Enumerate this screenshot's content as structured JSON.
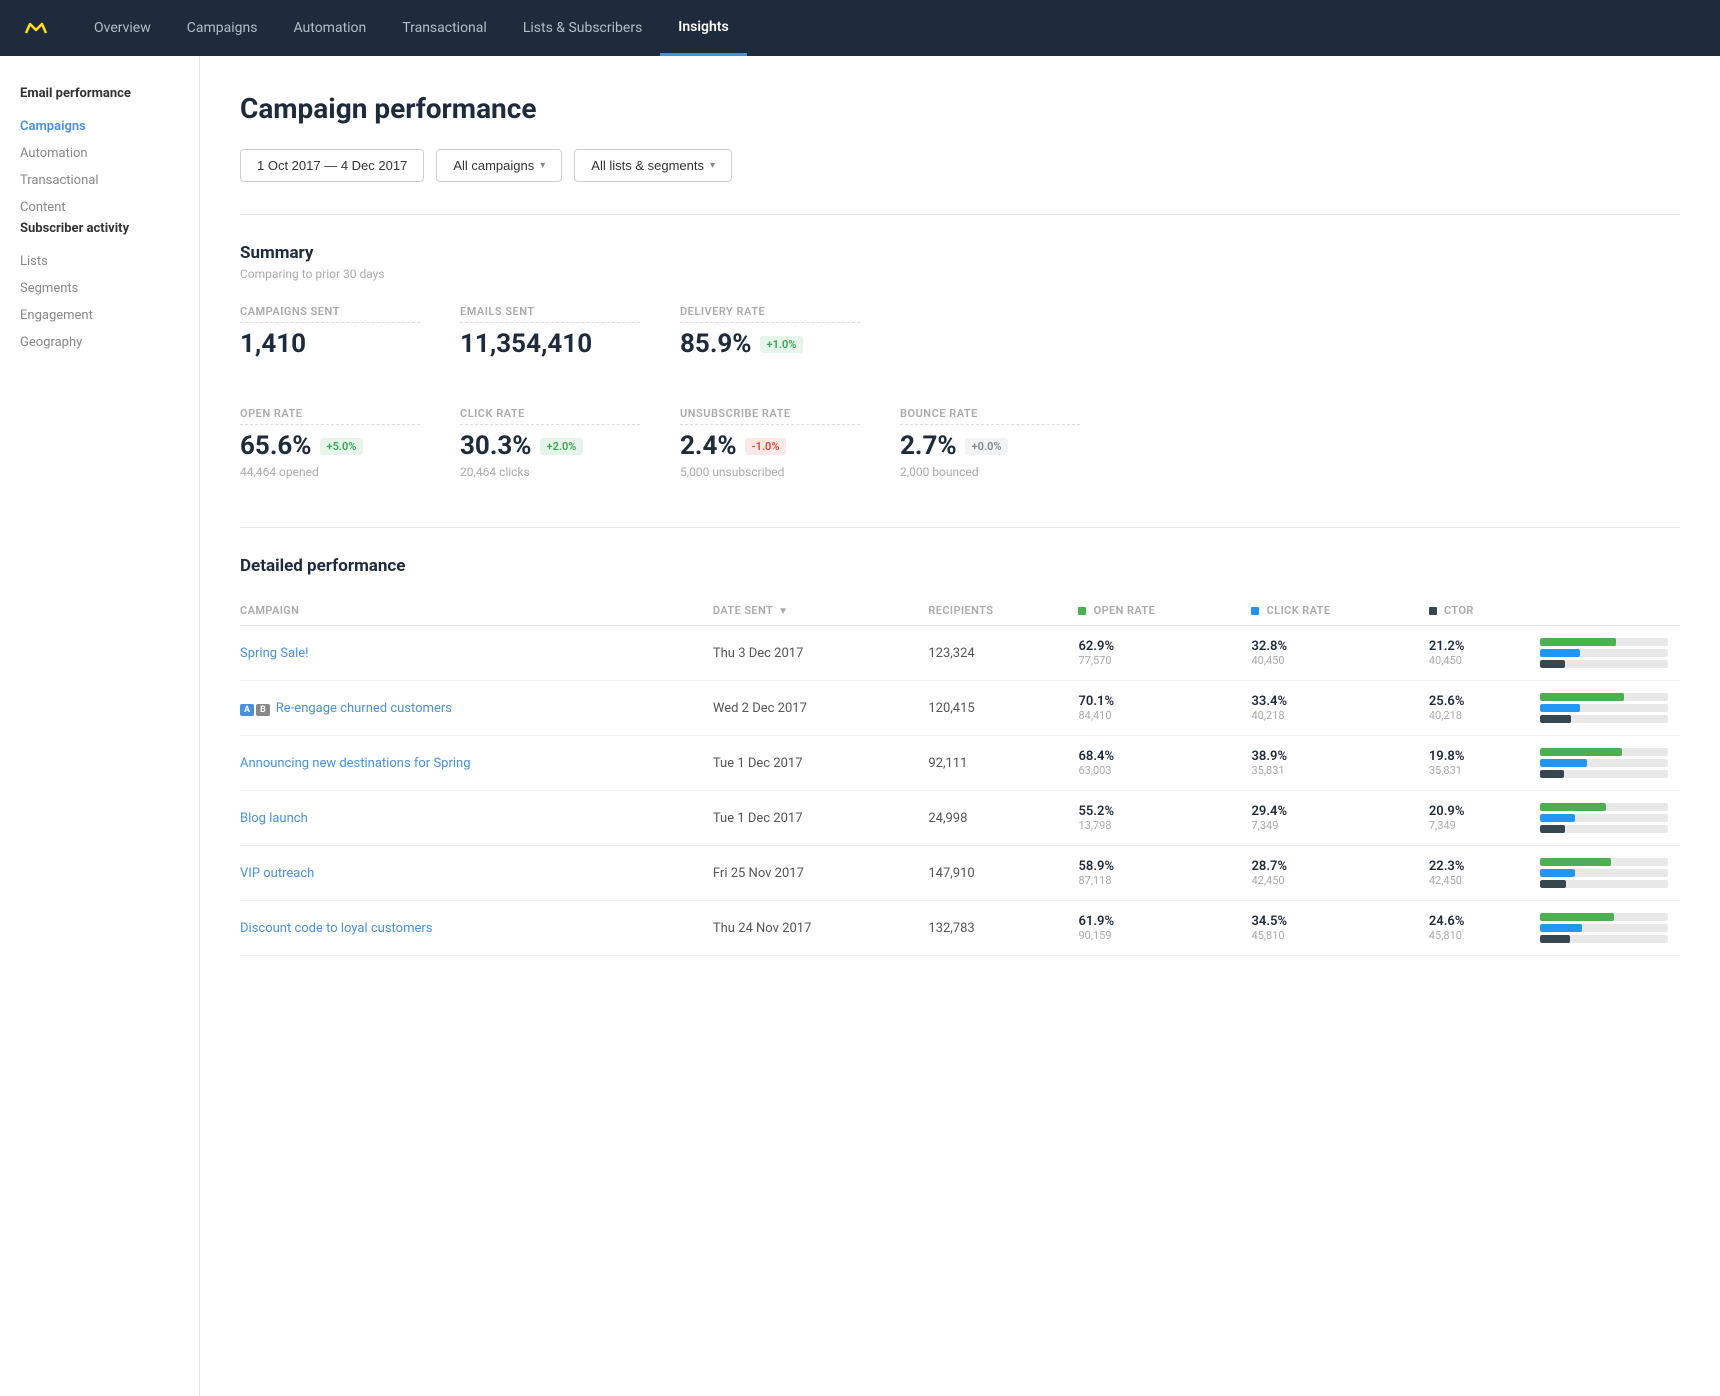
{
  "nav": {
    "logo_alt": "Mailchimp",
    "items": [
      {
        "label": "Overview",
        "active": false
      },
      {
        "label": "Campaigns",
        "active": false
      },
      {
        "label": "Automation",
        "active": false
      },
      {
        "label": "Transactional",
        "active": false
      },
      {
        "label": "Lists & Subscribers",
        "active": false
      },
      {
        "label": "Insights",
        "active": true
      }
    ]
  },
  "sidebar": {
    "sections": [
      {
        "title": "Email performance",
        "links": [
          {
            "label": "Campaigns",
            "active": true
          },
          {
            "label": "Automation",
            "active": false
          },
          {
            "label": "Transactional",
            "active": false
          },
          {
            "label": "Content",
            "active": false
          }
        ]
      },
      {
        "title": "Subscriber activity",
        "links": [
          {
            "label": "Lists",
            "active": false
          },
          {
            "label": "Segments",
            "active": false
          },
          {
            "label": "Engagement",
            "active": false
          },
          {
            "label": "Geography",
            "active": false
          }
        ]
      }
    ]
  },
  "page": {
    "title": "Campaign performance"
  },
  "filters": {
    "date_range": "1 Oct 2017 — 4 Dec 2017",
    "campaign_filter": "All campaigns",
    "segment_filter": "All lists & segments"
  },
  "summary": {
    "title": "Summary",
    "subtitle": "Comparing to prior 30 days",
    "stats_row1": [
      {
        "label": "CAMPAIGNS SENT",
        "value": "1,410",
        "sub": null,
        "badge": null
      },
      {
        "label": "EMAILS SENT",
        "value": "11,354,410",
        "sub": null,
        "badge": null
      },
      {
        "label": "DELIVERY RATE",
        "value": "85.9%",
        "sub": null,
        "badge": "+1.0%",
        "badge_type": "green"
      }
    ],
    "stats_row2": [
      {
        "label": "OPEN RATE",
        "value": "65.6%",
        "sub": "44,464 opened",
        "badge": "+5.0%",
        "badge_type": "green"
      },
      {
        "label": "CLICK RATE",
        "value": "30.3%",
        "sub": "20,464 clicks",
        "badge": "+2.0%",
        "badge_type": "green"
      },
      {
        "label": "UNSUBSCRIBE RATE",
        "value": "2.4%",
        "sub": "5,000 unsubscribed",
        "badge": "-1.0%",
        "badge_type": "red"
      },
      {
        "label": "BOUNCE RATE",
        "value": "2.7%",
        "sub": "2,000 bounced",
        "badge": "+0.0%",
        "badge_type": "gray"
      }
    ]
  },
  "detailed": {
    "title": "Detailed performance",
    "columns": {
      "campaign": "CAMPAIGN",
      "date_sent": "DATE SENT",
      "recipients": "RECIPIENTS",
      "open_rate": "OPEN RATE",
      "click_rate": "CLICK RATE",
      "ctor": "CTOR"
    },
    "rows": [
      {
        "name": "Spring Sale!",
        "ab": false,
        "date": "Thu 3 Dec 2017",
        "recipients": "123,324",
        "open_rate": "62.9%",
        "open_count": "77,570",
        "click_rate": "32.8%",
        "click_count": "40,450",
        "ctor": "21.2%",
        "ctor_count": "40,450",
        "open_pct": 63,
        "click_pct": 33,
        "ctor_pct": 21
      },
      {
        "name": "Re-engage churned customers",
        "ab": true,
        "date": "Wed 2 Dec 2017",
        "recipients": "120,415",
        "open_rate": "70.1%",
        "open_count": "84,410",
        "click_rate": "33.4%",
        "click_count": "40,218",
        "ctor": "25.6%",
        "ctor_count": "40,218",
        "open_pct": 70,
        "click_pct": 33,
        "ctor_pct": 26
      },
      {
        "name": "Announcing new destinations for Spring",
        "ab": false,
        "date": "Tue 1 Dec 2017",
        "recipients": "92,111",
        "open_rate": "68.4%",
        "open_count": "63,003",
        "click_rate": "38.9%",
        "click_count": "35,831",
        "ctor": "19.8%",
        "ctor_count": "35,831",
        "open_pct": 68,
        "click_pct": 39,
        "ctor_pct": 20
      },
      {
        "name": "Blog launch",
        "ab": false,
        "date": "Tue 1 Dec 2017",
        "recipients": "24,998",
        "open_rate": "55.2%",
        "open_count": "13,798",
        "click_rate": "29.4%",
        "click_count": "7,349",
        "ctor": "20.9%",
        "ctor_count": "7,349",
        "open_pct": 55,
        "click_pct": 29,
        "ctor_pct": 21
      },
      {
        "name": "VIP outreach",
        "ab": false,
        "date": "Fri 25 Nov 2017",
        "recipients": "147,910",
        "open_rate": "58.9%",
        "open_count": "87,118",
        "click_rate": "28.7%",
        "click_count": "42,450",
        "ctor": "22.3%",
        "ctor_count": "42,450",
        "open_pct": 59,
        "click_pct": 29,
        "ctor_pct": 22
      },
      {
        "name": "Discount code to loyal customers",
        "ab": false,
        "date": "Thu 24 Nov 2017",
        "recipients": "132,783",
        "open_rate": "61.9%",
        "open_count": "90,159",
        "click_rate": "34.5%",
        "click_count": "45,810",
        "ctor": "24.6%",
        "ctor_count": "45,810",
        "open_pct": 62,
        "click_pct": 35,
        "ctor_pct": 25
      }
    ]
  }
}
